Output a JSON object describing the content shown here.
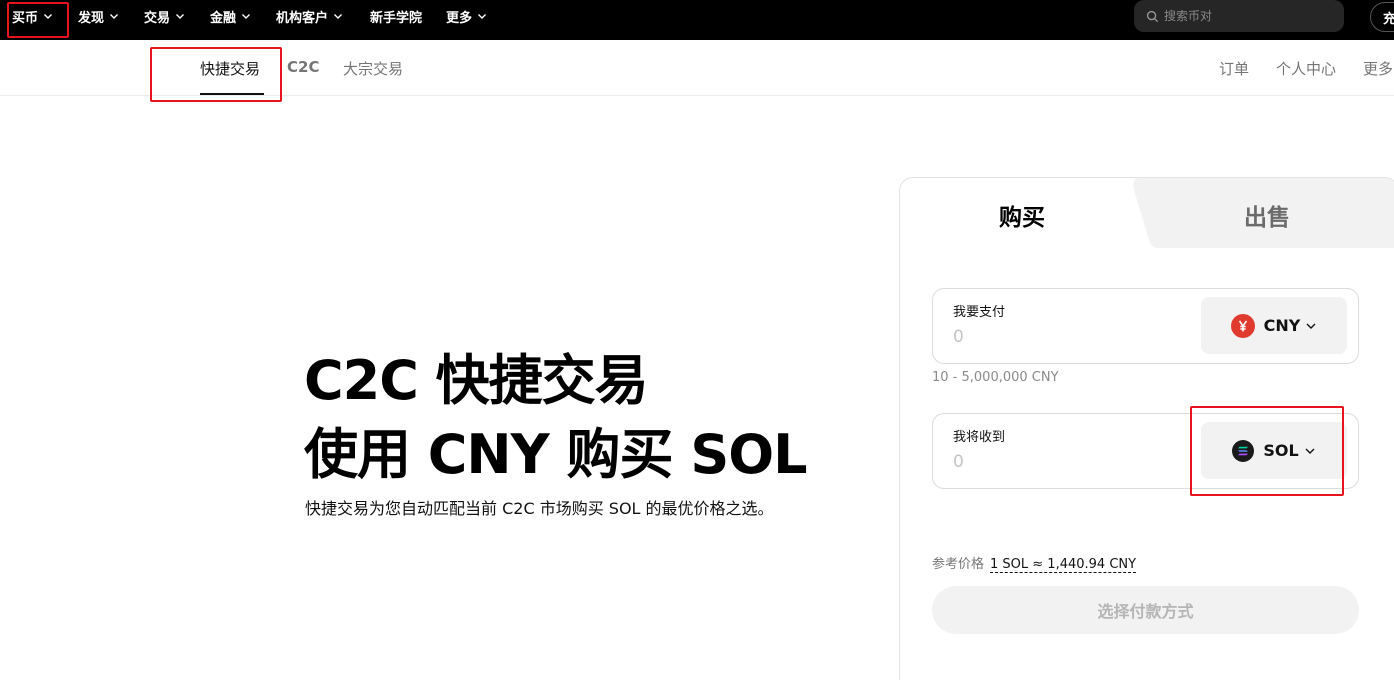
{
  "topnav": {
    "items": [
      {
        "label": "买币"
      },
      {
        "label": "发现"
      },
      {
        "label": "交易"
      },
      {
        "label": "金融"
      },
      {
        "label": "机构客户"
      },
      {
        "label": "新手学院"
      },
      {
        "label": "更多"
      }
    ],
    "search_placeholder": "搜索币对",
    "recharge_label": "充"
  },
  "subnav": {
    "tabs": [
      {
        "label": "快捷交易",
        "active": true
      },
      {
        "label": "C2C"
      },
      {
        "label": "大宗交易"
      }
    ],
    "right_links": [
      "订单",
      "个人中心",
      "更多"
    ]
  },
  "hero": {
    "title_line1": "C2C 快捷交易",
    "title_line2": "使用 CNY 购买 SOL",
    "description": "快捷交易为您自动匹配当前 C2C 市场购买 SOL 的最优价格之选。"
  },
  "trade_card": {
    "tab_buy": "购买",
    "tab_sell": "出售",
    "pay_field": {
      "label": "我要支付",
      "placeholder": "0",
      "currency": "CNY",
      "currency_icon": "yen-icon",
      "currency_color": "#e03a2f"
    },
    "range_hint": "10 - 5,000,000 CNY",
    "receive_field": {
      "label": "我将收到",
      "placeholder": "0",
      "currency": "SOL",
      "currency_icon": "solana-icon",
      "currency_color": "#1a1a1a"
    },
    "ref_price_label": "参考价格",
    "ref_price_value": "1 SOL ≈ 1,440.94 CNY",
    "submit_label": "选择付款方式"
  },
  "colors": {
    "nav_bg": "#000000",
    "highlight_box": "#e8141b",
    "disabled_button": "#f2f2f2"
  }
}
